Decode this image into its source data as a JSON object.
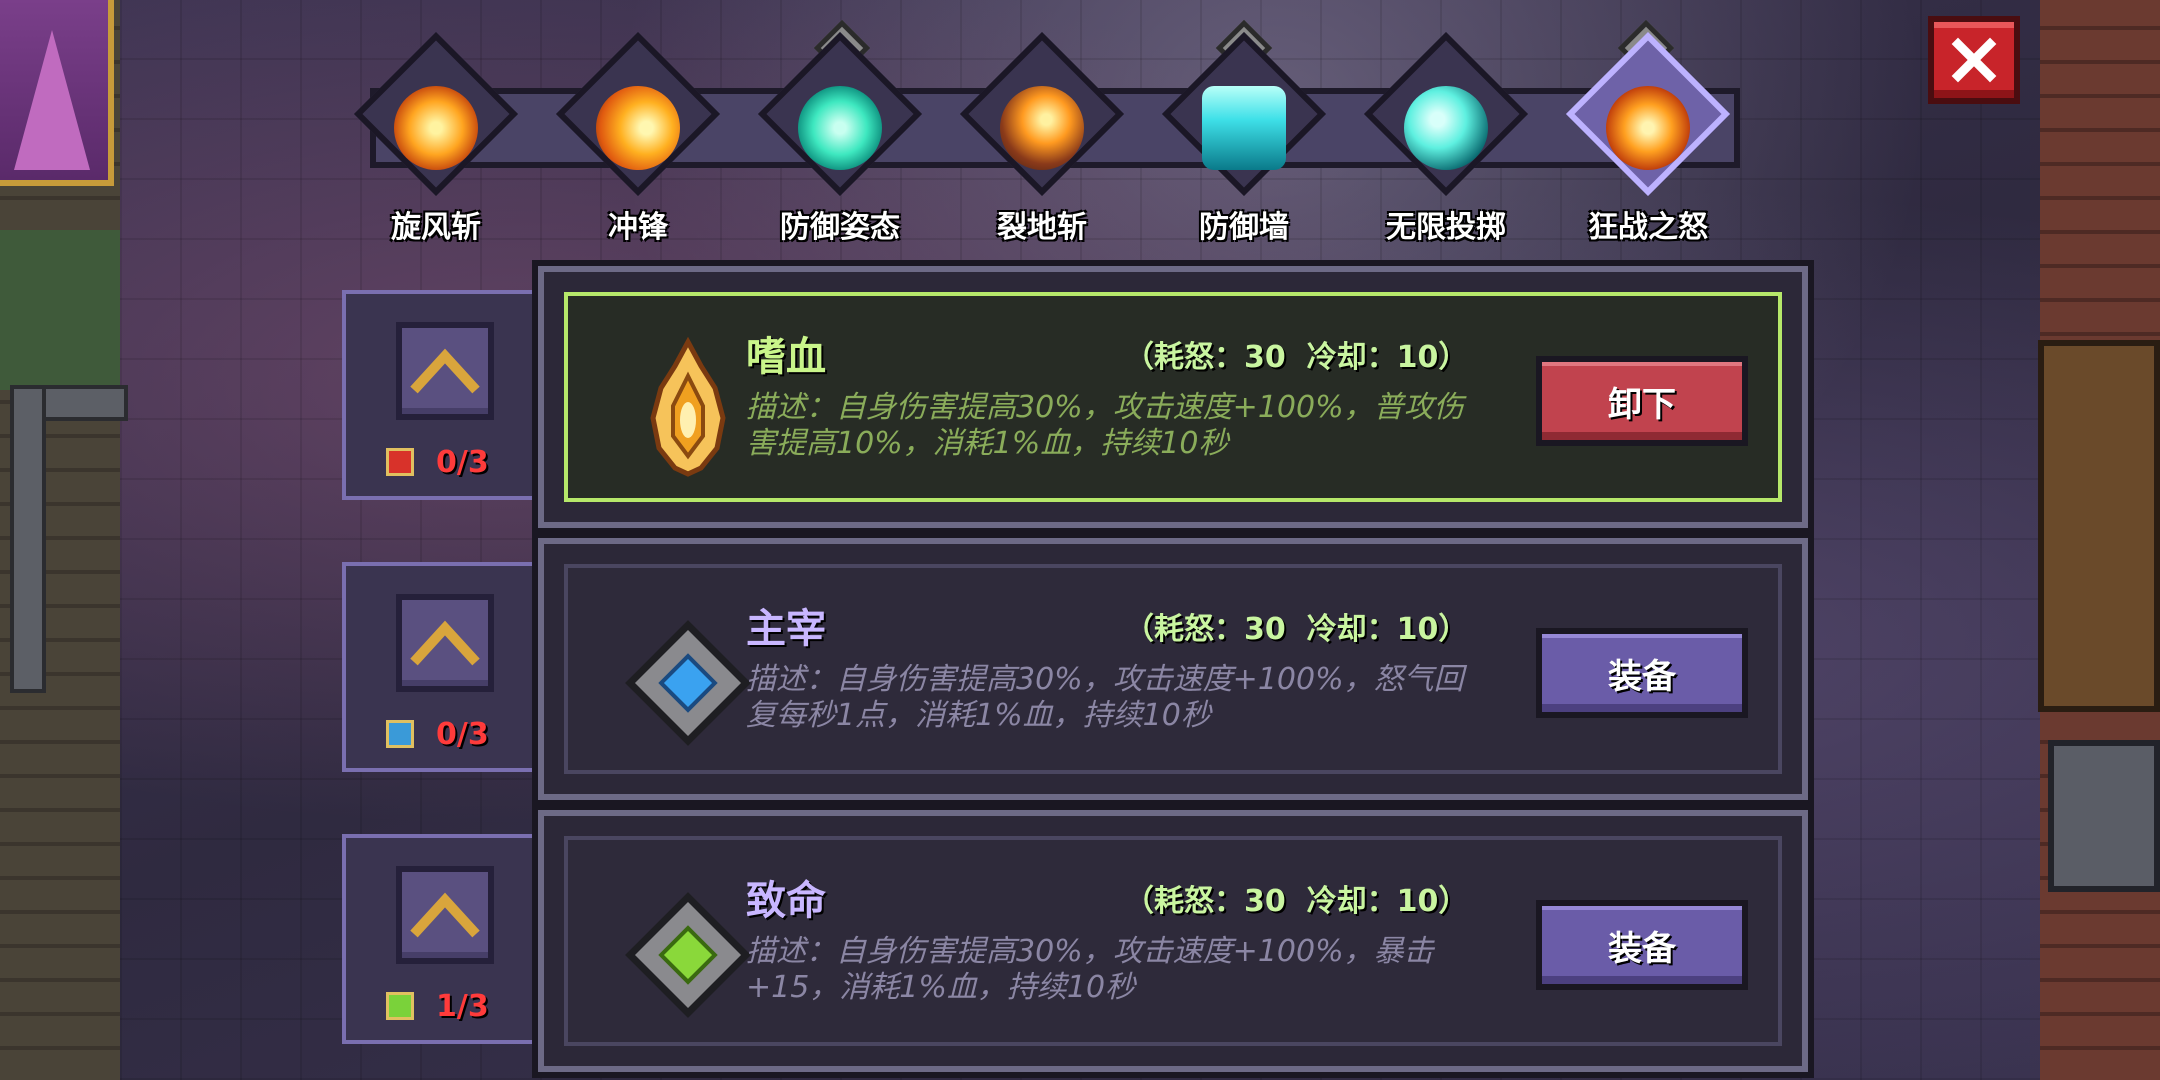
{
  "colors": {
    "close_red": "#c8242a",
    "selected_border": "#b6e86a",
    "unequip_red": "#c1434e",
    "equip_purple": "#6a5ca8",
    "level_red": "#ff3b3b"
  },
  "skill_tabs": [
    {
      "label": "旋风斩",
      "icon": "whirlwind-icon"
    },
    {
      "label": "冲锋",
      "icon": "charge-icon"
    },
    {
      "label": "防御姿态",
      "icon": "defense-stance-icon",
      "gem": "green"
    },
    {
      "label": "裂地斩",
      "icon": "ground-slash-icon"
    },
    {
      "label": "防御墙",
      "icon": "defense-wall-icon",
      "gem": "blue"
    },
    {
      "label": "无限投掷",
      "icon": "infinite-throw-icon"
    },
    {
      "label": "狂战之怒",
      "icon": "berserker-rage-icon",
      "gem": "red",
      "active": true
    }
  ],
  "runes": [
    {
      "name": "嗜血",
      "cost": "（耗怒：30  冷却：10）",
      "desc": "描述：自身伤害提高30%，攻击速度+100%，普攻伤害提高10%，消耗1%血，持续10秒",
      "button": "卸下",
      "level": "0/3",
      "icon": "bloodlust-flame-icon",
      "equipped": true
    },
    {
      "name": "主宰",
      "cost": "（耗怒：30  冷却：10）",
      "desc": "描述：自身伤害提高30%，攻击速度+100%，怒气回复每秒1点，消耗1%血，持续10秒",
      "button": "装备",
      "level": "0/3",
      "icon": "blue-gem-icon",
      "equipped": false
    },
    {
      "name": "致命",
      "cost": "（耗怒：30  冷却：10）",
      "desc": "描述：自身伤害提高30%，攻击速度+100%，暴击+15，消耗1%血，持续10秒",
      "button": "装备",
      "level": "1/3",
      "icon": "green-gem-icon",
      "equipped": false
    }
  ]
}
